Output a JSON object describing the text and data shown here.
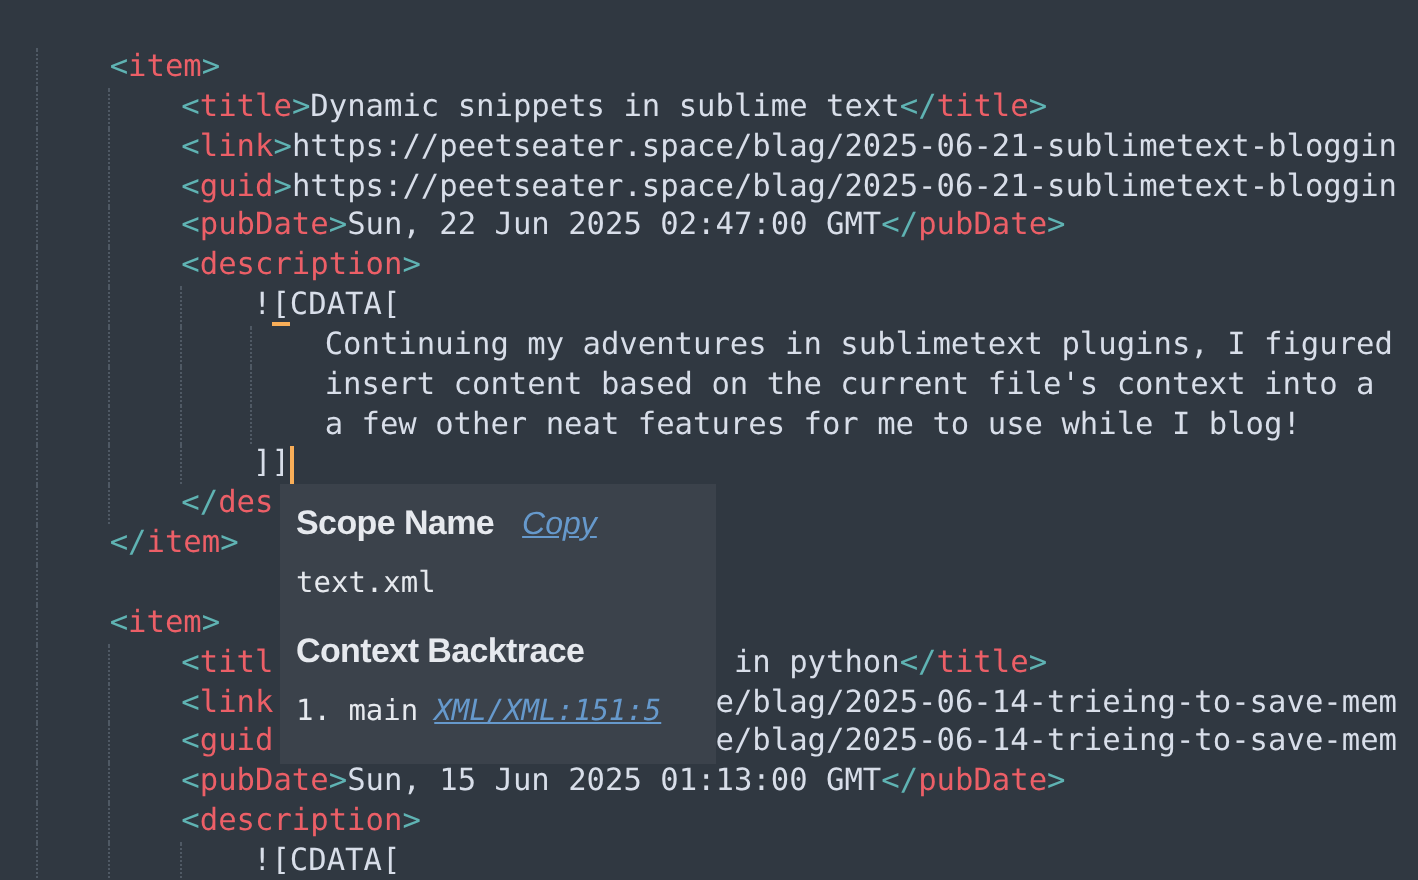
{
  "editor": {
    "lines": [
      {
        "tokens": [
          {
            "kind": "punct",
            "text": "    <"
          },
          {
            "kind": "tag",
            "text": "item"
          },
          {
            "kind": "punct",
            "text": ">"
          }
        ]
      },
      {
        "tokens": [
          {
            "kind": "punct",
            "text": "        <"
          },
          {
            "kind": "tag",
            "text": "title"
          },
          {
            "kind": "punct",
            "text": ">"
          },
          {
            "kind": "text",
            "text": "Dynamic snippets in sublime text"
          },
          {
            "kind": "punct",
            "text": "</"
          },
          {
            "kind": "tag",
            "text": "title"
          },
          {
            "kind": "punct",
            "text": ">"
          }
        ]
      },
      {
        "tokens": [
          {
            "kind": "punct",
            "text": "        <"
          },
          {
            "kind": "tag",
            "text": "link"
          },
          {
            "kind": "punct",
            "text": ">"
          },
          {
            "kind": "text",
            "text": "https://peetseater.space/blag/2025-06-21-sublimetext-bloggin"
          }
        ]
      },
      {
        "tokens": [
          {
            "kind": "punct",
            "text": "        <"
          },
          {
            "kind": "tag",
            "text": "guid"
          },
          {
            "kind": "punct",
            "text": ">"
          },
          {
            "kind": "text",
            "text": "https://peetseater.space/blag/2025-06-21-sublimetext-bloggin"
          }
        ]
      },
      {
        "tokens": [
          {
            "kind": "punct",
            "text": "        <"
          },
          {
            "kind": "tag",
            "text": "pubDate"
          },
          {
            "kind": "punct",
            "text": ">"
          },
          {
            "kind": "text",
            "text": "Sun, 22 Jun 2025 02:47:00 GMT"
          },
          {
            "kind": "punct",
            "text": "</"
          },
          {
            "kind": "tag",
            "text": "pubDate"
          },
          {
            "kind": "punct",
            "text": ">"
          }
        ]
      },
      {
        "tokens": [
          {
            "kind": "punct",
            "text": "        <"
          },
          {
            "kind": "tag",
            "text": "description"
          },
          {
            "kind": "punct",
            "text": ">"
          }
        ]
      },
      {
        "tokens": [
          {
            "kind": "text",
            "text": "            !"
          },
          {
            "kind": "match",
            "text": "["
          },
          {
            "kind": "text",
            "text": "CDATA["
          }
        ]
      },
      {
        "tokens": [
          {
            "kind": "text",
            "text": "                Continuing my adventures in sublimetext plugins, I figured"
          }
        ]
      },
      {
        "tokens": [
          {
            "kind": "text",
            "text": "                insert content based on the current file's context into a"
          }
        ]
      },
      {
        "tokens": [
          {
            "kind": "text",
            "text": "                a few other neat features for me to use while I blog!"
          }
        ]
      },
      {
        "tokens": [
          {
            "kind": "text",
            "text": "            ]]"
          }
        ],
        "cursor": true
      },
      {
        "tokens": [
          {
            "kind": "punct",
            "text": "        </"
          },
          {
            "kind": "tag",
            "text": "des"
          }
        ]
      },
      {
        "tokens": [
          {
            "kind": "punct",
            "text": "    </"
          },
          {
            "kind": "tag",
            "text": "item"
          },
          {
            "kind": "punct",
            "text": ">"
          }
        ]
      },
      {
        "blank_before": true,
        "tokens": [
          {
            "kind": "punct",
            "text": "    <"
          },
          {
            "kind": "tag",
            "text": "item"
          },
          {
            "kind": "punct",
            "text": ">"
          }
        ]
      },
      {
        "tokens": [
          {
            "kind": "punct",
            "text": "        <"
          },
          {
            "kind": "tag",
            "text": "titl"
          }
        ],
        "right": [
          {
            "kind": "text",
            "text": " in python"
          },
          {
            "kind": "punct",
            "text": "</"
          },
          {
            "kind": "tag",
            "text": "title"
          },
          {
            "kind": "punct",
            "text": ">"
          }
        ]
      },
      {
        "tokens": [
          {
            "kind": "punct",
            "text": "        <"
          },
          {
            "kind": "tag",
            "text": "link"
          }
        ],
        "right": [
          {
            "kind": "text",
            "text": "e/blag/2025-06-14-trieing-to-save-mem"
          }
        ]
      },
      {
        "tokens": [
          {
            "kind": "punct",
            "text": "        <"
          },
          {
            "kind": "tag",
            "text": "guid"
          }
        ],
        "right": [
          {
            "kind": "text",
            "text": "e/blag/2025-06-14-trieing-to-save-mem"
          }
        ]
      },
      {
        "tokens": [
          {
            "kind": "punct",
            "text": "        <"
          },
          {
            "kind": "tag",
            "text": "pubDate"
          },
          {
            "kind": "punct",
            "text": ">"
          },
          {
            "kind": "text",
            "text": "Sun, 15 Jun 2025 01:13:00 GMT"
          },
          {
            "kind": "punct",
            "text": "</"
          },
          {
            "kind": "tag",
            "text": "pubDate"
          },
          {
            "kind": "punct",
            "text": ">"
          }
        ]
      },
      {
        "tokens": [
          {
            "kind": "punct",
            "text": "        <"
          },
          {
            "kind": "tag",
            "text": "description"
          },
          {
            "kind": "punct",
            "text": ">"
          }
        ]
      },
      {
        "tokens": [
          {
            "kind": "text",
            "text": "            ![CDATA["
          }
        ]
      }
    ]
  },
  "popup": {
    "scope_heading": "Scope Name",
    "copy_link": "Copy",
    "scope": "text.xml",
    "backtrace_heading": "Context Backtrace",
    "backtrace": [
      {
        "number": "1.",
        "context": "main",
        "location": "XML/XML:151:5"
      }
    ]
  }
}
